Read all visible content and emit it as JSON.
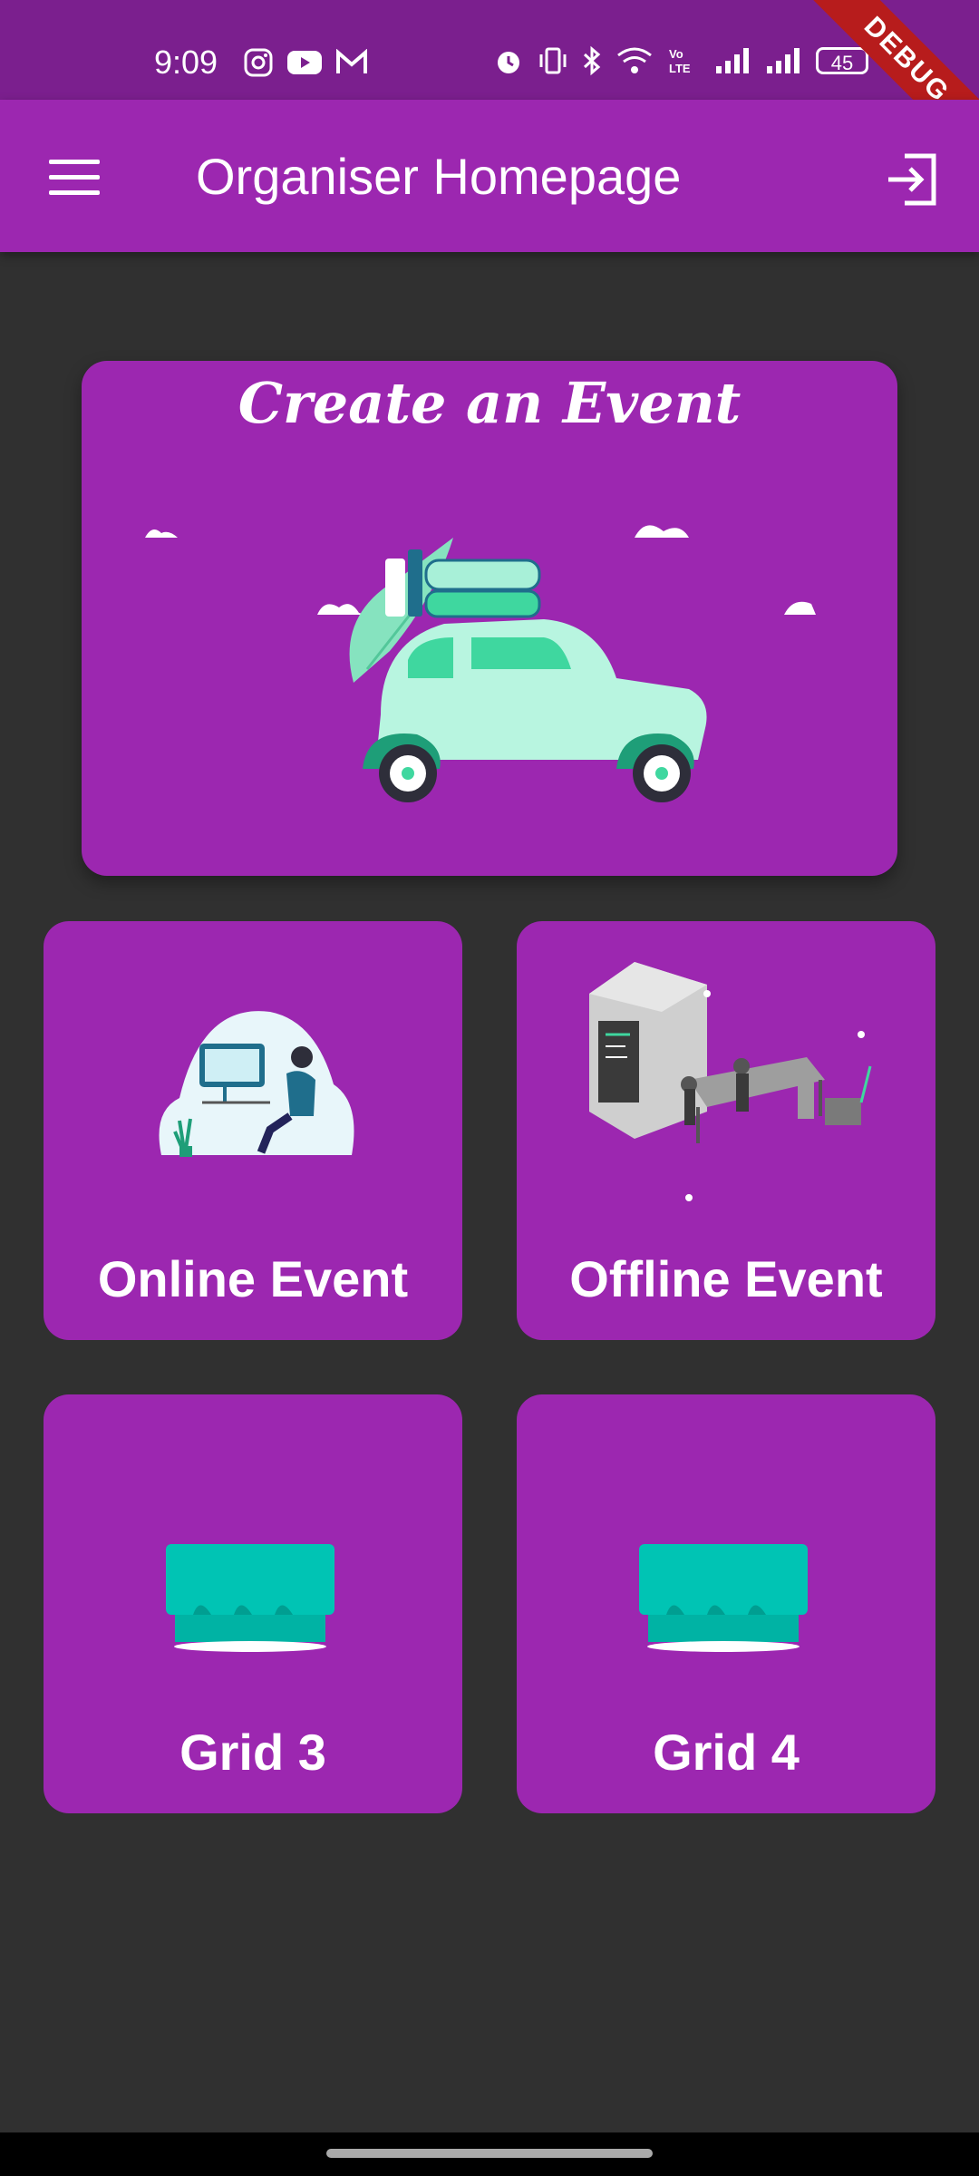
{
  "status_bar": {
    "time": "9:09",
    "left_icons": [
      "instagram-icon",
      "youtube-icon",
      "gmail-icon"
    ],
    "right_icons": [
      "alarm-icon",
      "vibrate-icon",
      "bluetooth-icon",
      "wifi-icon",
      "volte-icon",
      "signal-icon",
      "signal-icon",
      "battery-icon"
    ],
    "battery": "45",
    "debug_label": "DEBUG"
  },
  "app_bar": {
    "title": "Organiser Homepage",
    "menu_icon": "menu-icon",
    "logout_icon": "logout-icon"
  },
  "create_card": {
    "title": "Create an Event",
    "illustration": "car-with-luggage-illustration"
  },
  "tiles": [
    {
      "label": "Online Event",
      "illustration": "person-at-computer-illustration"
    },
    {
      "label": "Offline Event",
      "illustration": "factory-conveyor-illustration"
    },
    {
      "label": "Grid 3",
      "illustration": "planter-illustration"
    },
    {
      "label": "Grid 4",
      "illustration": "planter-illustration"
    }
  ],
  "colors": {
    "background": "#303030",
    "primary": "#9C27B0",
    "status_bar": "#7B1F8E",
    "accent": "#00C4B4"
  }
}
